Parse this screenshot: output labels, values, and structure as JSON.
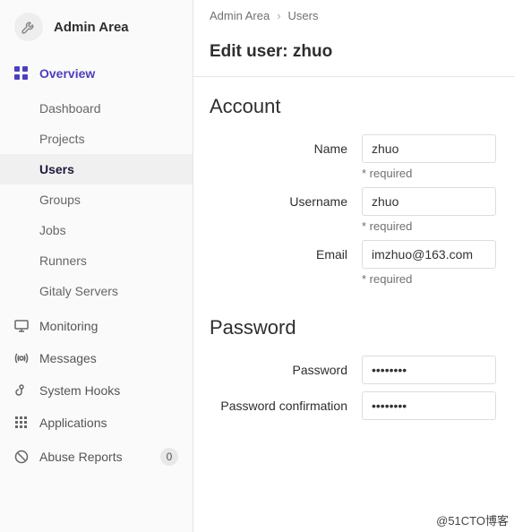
{
  "sidebar": {
    "title": "Admin Area",
    "overview_label": "Overview",
    "sub_items": [
      {
        "label": "Dashboard"
      },
      {
        "label": "Projects"
      },
      {
        "label": "Users"
      },
      {
        "label": "Groups"
      },
      {
        "label": "Jobs"
      },
      {
        "label": "Runners"
      },
      {
        "label": "Gitaly Servers"
      }
    ],
    "items": [
      {
        "label": "Monitoring"
      },
      {
        "label": "Messages"
      },
      {
        "label": "System Hooks"
      },
      {
        "label": "Applications"
      },
      {
        "label": "Abuse Reports",
        "badge": "0"
      }
    ]
  },
  "breadcrumb": {
    "root": "Admin Area",
    "current": "Users"
  },
  "page": {
    "title": "Edit user: zhuo"
  },
  "account": {
    "heading": "Account",
    "name_label": "Name",
    "name_value": "zhuo",
    "name_hint": "* required",
    "username_label": "Username",
    "username_value": "zhuo",
    "username_hint": "* required",
    "email_label": "Email",
    "email_value": "imzhuo@163.com",
    "email_hint": "* required"
  },
  "password": {
    "heading": "Password",
    "password_label": "Password",
    "password_value": "••••••••",
    "confirm_label": "Password confirmation",
    "confirm_value": "••••••••"
  },
  "watermark": "@51CTO博客"
}
